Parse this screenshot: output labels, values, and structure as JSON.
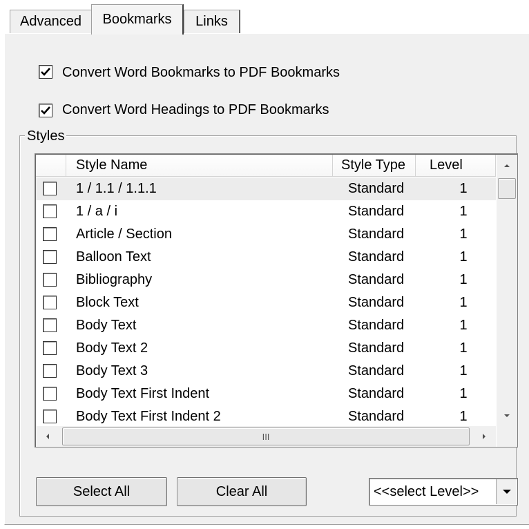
{
  "tabs": [
    {
      "label": "Advanced",
      "selected": false
    },
    {
      "label": "Bookmarks",
      "selected": true
    },
    {
      "label": "Links",
      "selected": false
    }
  ],
  "options": [
    {
      "label": "Convert Word Bookmarks to PDF Bookmarks",
      "checked": true
    },
    {
      "label": "Convert Word Headings to PDF Bookmarks",
      "checked": true
    }
  ],
  "styles_group": {
    "label": "Styles",
    "columns": {
      "name": "Style Name",
      "type": "Style Type",
      "level": "Level"
    },
    "rows": [
      {
        "name": "1 / 1.1 / 1.1.1",
        "type": "Standard",
        "level": "1",
        "checked": false
      },
      {
        "name": "1 / a / i",
        "type": "Standard",
        "level": "1",
        "checked": false
      },
      {
        "name": "Article / Section",
        "type": "Standard",
        "level": "1",
        "checked": false
      },
      {
        "name": "Balloon Text",
        "type": "Standard",
        "level": "1",
        "checked": false
      },
      {
        "name": "Bibliography",
        "type": "Standard",
        "level": "1",
        "checked": false
      },
      {
        "name": "Block Text",
        "type": "Standard",
        "level": "1",
        "checked": false
      },
      {
        "name": "Body Text",
        "type": "Standard",
        "level": "1",
        "checked": false
      },
      {
        "name": "Body Text 2",
        "type": "Standard",
        "level": "1",
        "checked": false
      },
      {
        "name": "Body Text 3",
        "type": "Standard",
        "level": "1",
        "checked": false
      },
      {
        "name": "Body Text First Indent",
        "type": "Standard",
        "level": "1",
        "checked": false
      },
      {
        "name": "Body Text First Indent 2",
        "type": "Standard",
        "level": "1",
        "checked": false
      }
    ],
    "hscroll_grip": "III"
  },
  "buttons": {
    "select_all": "Select All",
    "clear_all": "Clear All"
  },
  "level_select": {
    "value": "<<select Level>>"
  },
  "colors": {
    "panel": "#f0f0f0",
    "highlight_row": "#ececec",
    "border": "#a0a0a0"
  }
}
